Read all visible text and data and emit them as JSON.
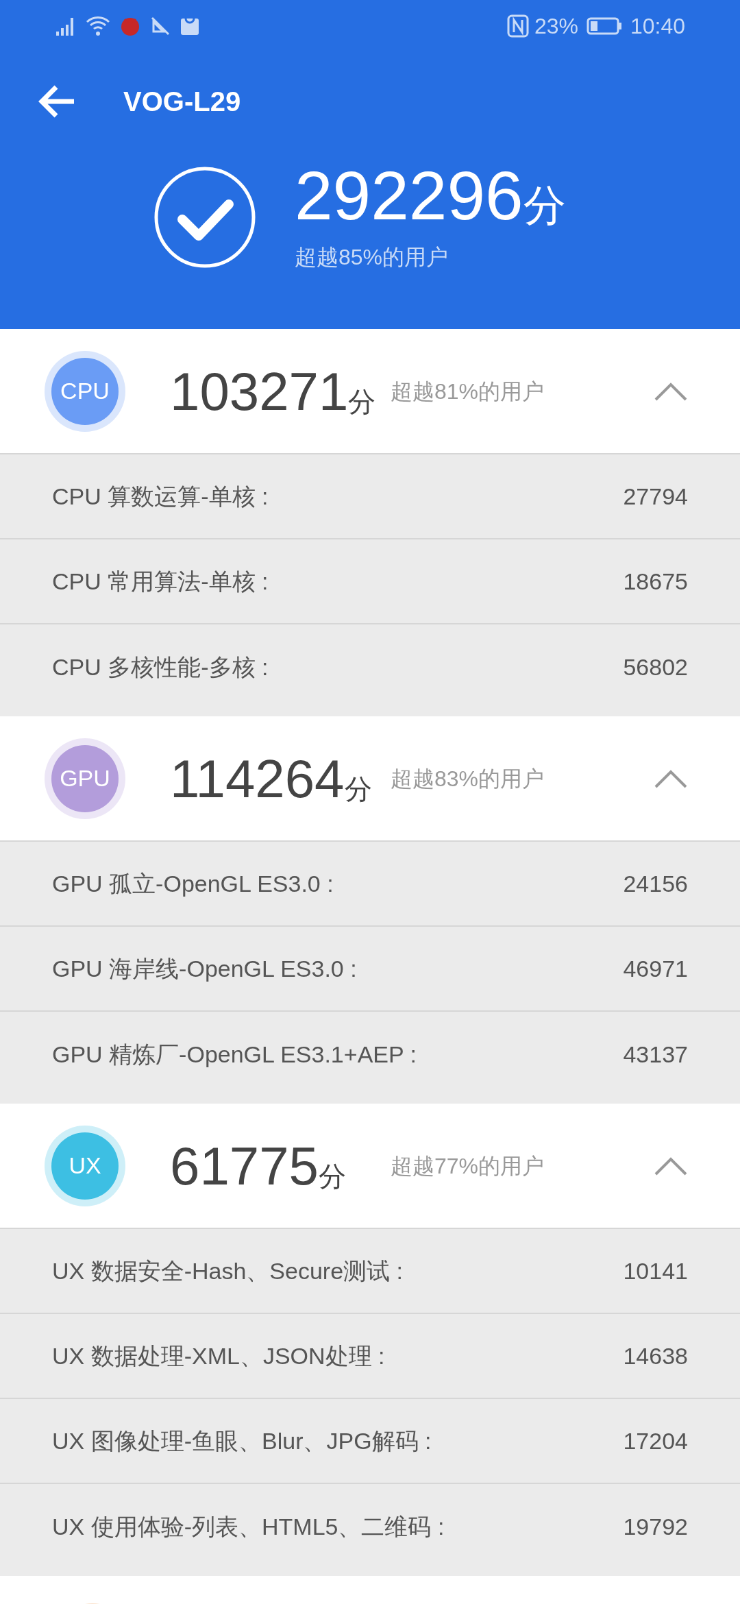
{
  "status_bar": {
    "battery_percent": "23%",
    "time": "10:40"
  },
  "toolbar": {
    "title": "VOG-L29"
  },
  "total": {
    "score": "292296",
    "unit": "分",
    "rank": "超越85%的用户"
  },
  "sections": [
    {
      "badge": "CPU",
      "color": "#6a9cf5",
      "score": "103271",
      "unit": "分",
      "rank": "超越81%的用户",
      "expanded": true,
      "items": [
        {
          "label": "CPU 算数运算-单核 :",
          "value": "27794"
        },
        {
          "label": "CPU 常用算法-单核 :",
          "value": "18675"
        },
        {
          "label": "CPU 多核性能-多核 :",
          "value": "56802"
        }
      ]
    },
    {
      "badge": "GPU",
      "color": "#b39ddb",
      "score": "114264",
      "unit": "分",
      "rank": "超越83%的用户",
      "expanded": true,
      "items": [
        {
          "label": "GPU 孤立-OpenGL ES3.0 :",
          "value": "24156"
        },
        {
          "label": "GPU 海岸线-OpenGL ES3.0 :",
          "value": "46971"
        },
        {
          "label": "GPU 精炼厂-OpenGL ES3.1+AEP :",
          "value": "43137"
        }
      ]
    },
    {
      "badge": "UX",
      "color": "#3dbfe3",
      "score": "61775",
      "unit": "分",
      "rank": "超越77%的用户",
      "expanded": true,
      "items": [
        {
          "label": "UX 数据安全-Hash、Secure测试 :",
          "value": "10141"
        },
        {
          "label": "UX 数据处理-XML、JSON处理 :",
          "value": "14638"
        },
        {
          "label": "UX 图像处理-鱼眼、Blur、JPG解码 :",
          "value": "17204"
        },
        {
          "label": "UX 使用体验-列表、HTML5、二维码 :",
          "value": "19792"
        }
      ]
    }
  ]
}
